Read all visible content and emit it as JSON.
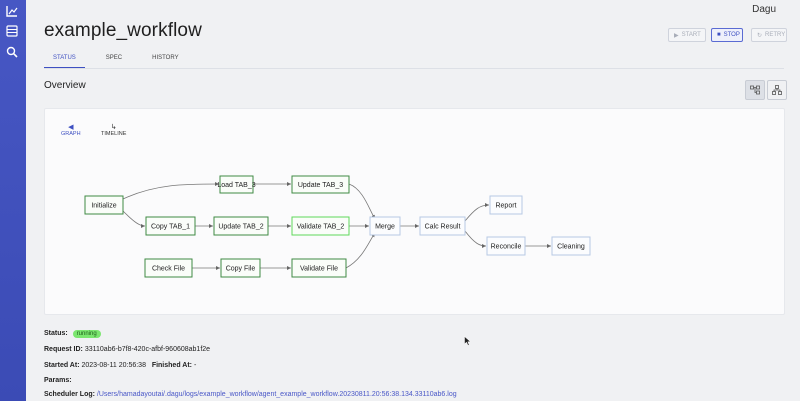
{
  "app": {
    "name": "Dagu"
  },
  "page": {
    "title": "example_workflow"
  },
  "actions": {
    "start": "START",
    "stop": "STOP",
    "retry": "RETRY"
  },
  "tabs": [
    "STATUS",
    "SPEC",
    "HISTORY"
  ],
  "overview": {
    "heading": "Overview"
  },
  "subtabs": {
    "graph": "GRAPH",
    "timeline": "TIMELINE"
  },
  "nodes": {
    "initialize": "Initialize",
    "load_tab3": "Load TAB_3",
    "update_tab3": "Update TAB_3",
    "copy_tab1": "Copy TAB_1",
    "update_tab2": "Update TAB_2",
    "validate_tab2": "Validate TAB_2",
    "merge": "Merge",
    "calc_result": "Calc Result",
    "report": "Report",
    "reconcile": "Reconcile",
    "cleaning": "Cleaning",
    "check_file": "Check File",
    "copy_file": "Copy File",
    "validate_file": "Validate File"
  },
  "status": {
    "status_label": "Status:",
    "status_value": "running",
    "request_label": "Request ID:",
    "request_value": "33110ab6-b7f8-420c-afbf-960608ab1f2e",
    "started_label": "Started At:",
    "started_value": "2023-08-11 20:56:38",
    "finished_label": "Finished At:",
    "finished_value": "-",
    "params_label": "Params:",
    "log_label": "Scheduler Log:",
    "log_value": "/Users/hamadayoutai/.dagu/logs/example_workflow/agent_example_workflow.20230811.20:56:38.134.33110ab6.log"
  },
  "colors": {
    "sidebar": "#3f50bd",
    "accent": "#3e50c2",
    "running": "#7be66f",
    "success_border": "#3f8a43"
  }
}
